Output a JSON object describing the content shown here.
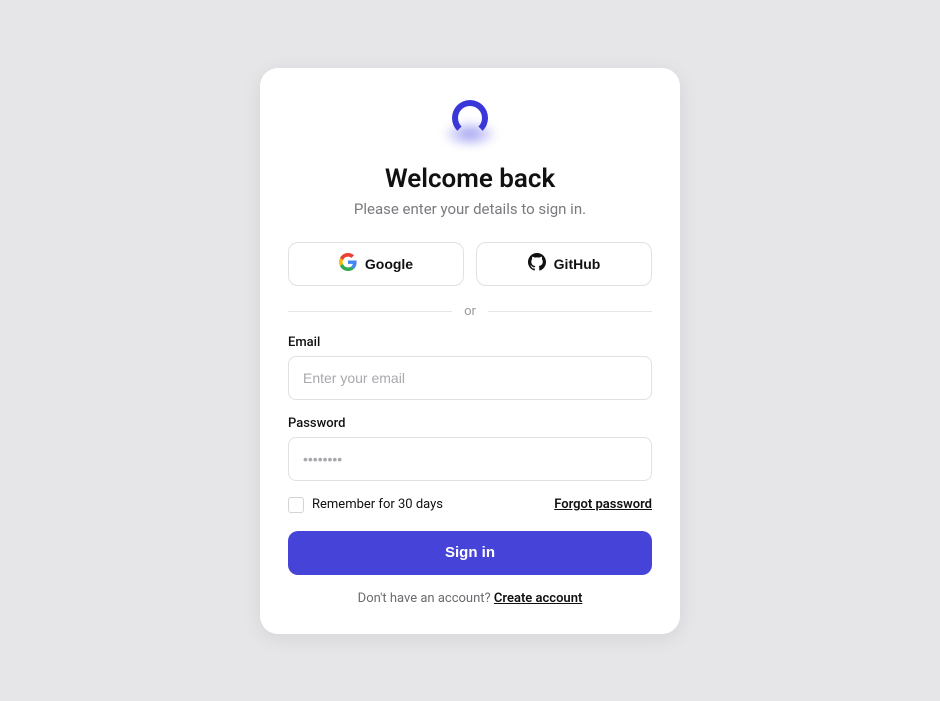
{
  "title": "Welcome back",
  "subtitle": "Please enter your details to sign in.",
  "social": {
    "google": "Google",
    "github": "GitHub"
  },
  "divider": "or",
  "email": {
    "label": "Email",
    "placeholder": "Enter your email",
    "value": ""
  },
  "password": {
    "label": "Password",
    "placeholder": "••••••••",
    "value": ""
  },
  "remember": {
    "label": "Remember for 30 days",
    "checked": false
  },
  "forgot": "Forgot password",
  "submit": "Sign in",
  "footer": {
    "prompt": "Don't have an account? ",
    "link": "Create account"
  },
  "colors": {
    "accent": "#4643d8",
    "background": "#e6e6e9"
  }
}
